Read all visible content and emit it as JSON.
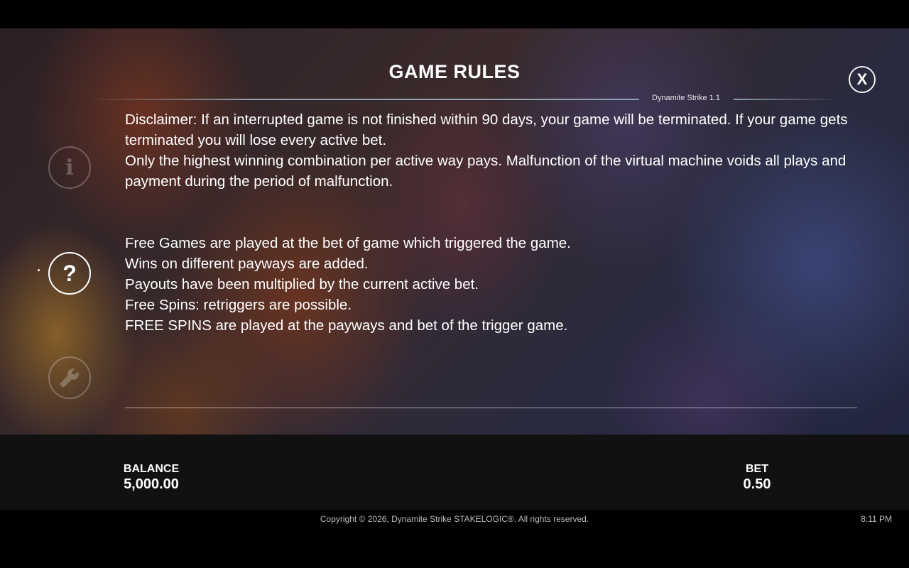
{
  "header": {
    "title": "GAME RULES",
    "version": "Dynamite Strike 1.1",
    "close_label": "X"
  },
  "side_menu": {
    "info_glyph": "i",
    "help_glyph": "?",
    "active": "help"
  },
  "rules": {
    "block1": [
      "Disclaimer: If an interrupted game is not finished within 90 days, your game will be terminated. If your game gets terminated you will lose every active bet.",
      "Only the highest winning combination per active way pays. Malfunction of the virtual machine voids all plays and payment during the period of malfunction."
    ],
    "block2": [
      "Free Games are played at the bet of game which triggered the game.",
      "Wins on different payways are added.",
      "Payouts have been multiplied by the current active bet.",
      "Free Spins: retriggers are possible.",
      "FREE SPINS are played at the payways and bet of the trigger game."
    ]
  },
  "hud": {
    "balance_label": "BALANCE",
    "balance_value": "5,000.00",
    "bet_label": "BET",
    "bet_value": "0.50"
  },
  "footer": {
    "copyright": "Copyright © 2026, Dynamite Strike STAKELOGIC®. All rights reserved.",
    "time": "8:11 PM"
  }
}
